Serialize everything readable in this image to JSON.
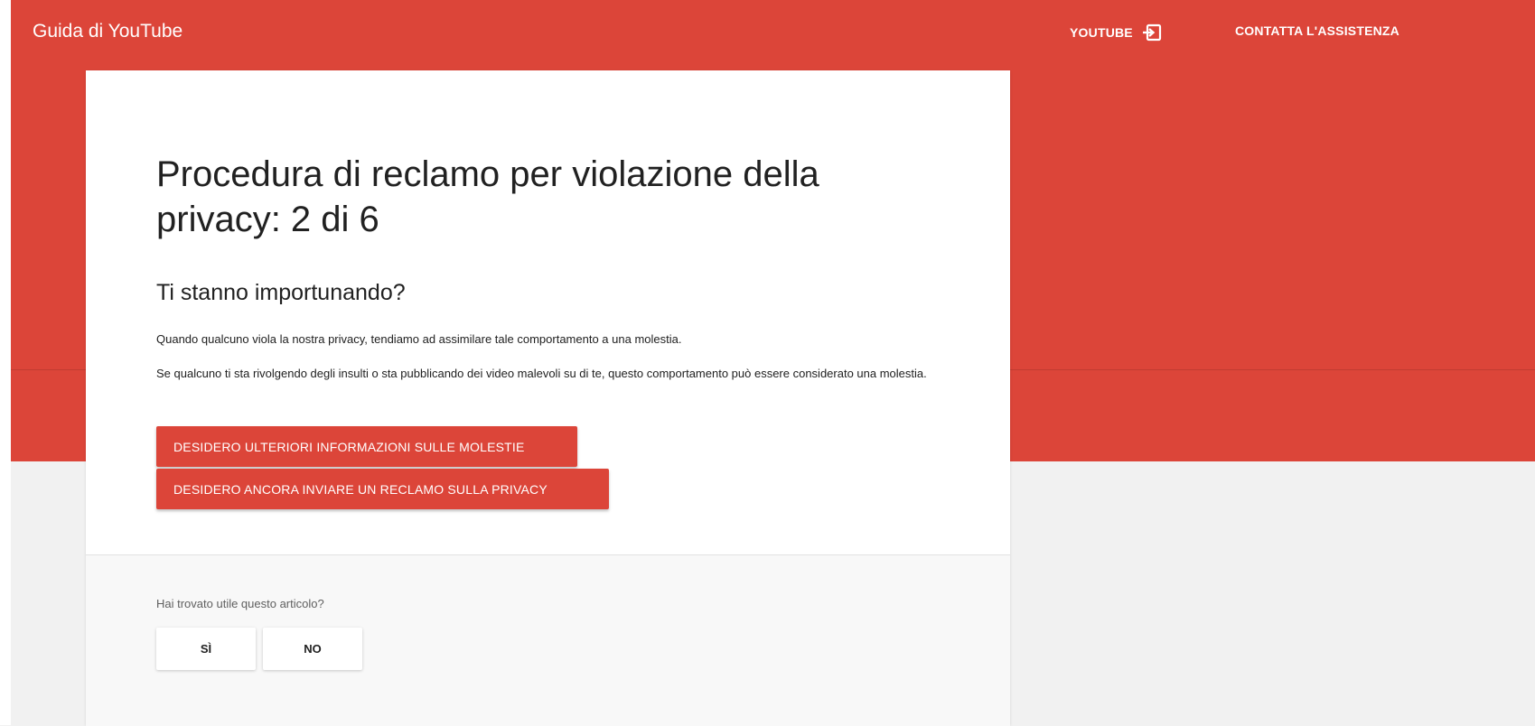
{
  "header": {
    "title": "Guida di YouTube",
    "youtube_link": "YOUTUBE",
    "contact_link": "CONTATTA L'ASSISTENZA"
  },
  "article": {
    "title": "Procedura di reclamo per violazione della privacy: 2 di 6",
    "section_heading": "Ti stanno importunando?",
    "paragraph1": "Quando qualcuno viola la nostra privacy, tendiamo ad assimilare tale comportamento a una molestia.",
    "paragraph2": "Se qualcuno ti sta rivolgendo degli insulti o sta pubblicando dei video malevoli su di te, questo comportamento può essere considerato una molestia.",
    "button_harassment": "DESIDERO ULTERIORI INFORMAZIONI SULLE MOLESTIE",
    "button_privacy": "DESIDERO ANCORA INVIARE UN RECLAMO SULLA PRIVACY"
  },
  "feedback": {
    "question": "Hai trovato utile questo articolo?",
    "yes_label": "SÌ",
    "no_label": "NO"
  },
  "colors": {
    "brand_red": "#dc4539",
    "page_background": "#f1f1f1",
    "card_background": "#ffffff",
    "footer_background": "#f8f8f8"
  },
  "icons": {
    "youtube_link_icon": "exit-icon"
  }
}
